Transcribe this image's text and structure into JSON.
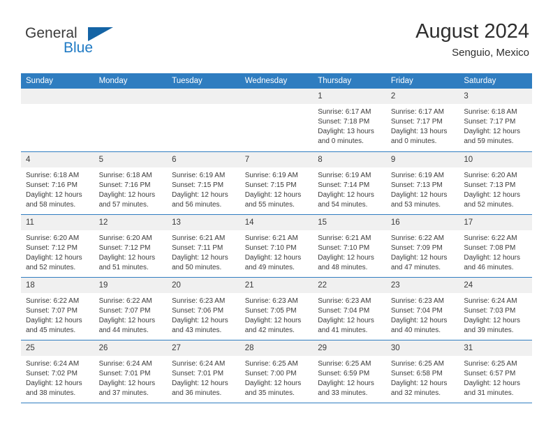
{
  "brand": {
    "name_part1": "General",
    "name_part2": "Blue",
    "flag_icon": "triangle-flag-icon"
  },
  "header": {
    "title": "August 2024",
    "subtitle": "Senguio, Mexico"
  },
  "colors": {
    "header_blue": "#2f7dc0",
    "brand_blue": "#1f7ac4",
    "daynum_bg": "#f0f0f0",
    "text": "#3a3a3a"
  },
  "weekdays": [
    "Sunday",
    "Monday",
    "Tuesday",
    "Wednesday",
    "Thursday",
    "Friday",
    "Saturday"
  ],
  "weeks": [
    [
      {
        "day": "",
        "empty": true
      },
      {
        "day": "",
        "empty": true
      },
      {
        "day": "",
        "empty": true
      },
      {
        "day": "",
        "empty": true
      },
      {
        "day": "1",
        "sunrise": "Sunrise: 6:17 AM",
        "sunset": "Sunset: 7:18 PM",
        "daylight1": "Daylight: 13 hours",
        "daylight2": "and 0 minutes."
      },
      {
        "day": "2",
        "sunrise": "Sunrise: 6:17 AM",
        "sunset": "Sunset: 7:17 PM",
        "daylight1": "Daylight: 13 hours",
        "daylight2": "and 0 minutes."
      },
      {
        "day": "3",
        "sunrise": "Sunrise: 6:18 AM",
        "sunset": "Sunset: 7:17 PM",
        "daylight1": "Daylight: 12 hours",
        "daylight2": "and 59 minutes."
      }
    ],
    [
      {
        "day": "4",
        "sunrise": "Sunrise: 6:18 AM",
        "sunset": "Sunset: 7:16 PM",
        "daylight1": "Daylight: 12 hours",
        "daylight2": "and 58 minutes."
      },
      {
        "day": "5",
        "sunrise": "Sunrise: 6:18 AM",
        "sunset": "Sunset: 7:16 PM",
        "daylight1": "Daylight: 12 hours",
        "daylight2": "and 57 minutes."
      },
      {
        "day": "6",
        "sunrise": "Sunrise: 6:19 AM",
        "sunset": "Sunset: 7:15 PM",
        "daylight1": "Daylight: 12 hours",
        "daylight2": "and 56 minutes."
      },
      {
        "day": "7",
        "sunrise": "Sunrise: 6:19 AM",
        "sunset": "Sunset: 7:15 PM",
        "daylight1": "Daylight: 12 hours",
        "daylight2": "and 55 minutes."
      },
      {
        "day": "8",
        "sunrise": "Sunrise: 6:19 AM",
        "sunset": "Sunset: 7:14 PM",
        "daylight1": "Daylight: 12 hours",
        "daylight2": "and 54 minutes."
      },
      {
        "day": "9",
        "sunrise": "Sunrise: 6:19 AM",
        "sunset": "Sunset: 7:13 PM",
        "daylight1": "Daylight: 12 hours",
        "daylight2": "and 53 minutes."
      },
      {
        "day": "10",
        "sunrise": "Sunrise: 6:20 AM",
        "sunset": "Sunset: 7:13 PM",
        "daylight1": "Daylight: 12 hours",
        "daylight2": "and 52 minutes."
      }
    ],
    [
      {
        "day": "11",
        "sunrise": "Sunrise: 6:20 AM",
        "sunset": "Sunset: 7:12 PM",
        "daylight1": "Daylight: 12 hours",
        "daylight2": "and 52 minutes."
      },
      {
        "day": "12",
        "sunrise": "Sunrise: 6:20 AM",
        "sunset": "Sunset: 7:12 PM",
        "daylight1": "Daylight: 12 hours",
        "daylight2": "and 51 minutes."
      },
      {
        "day": "13",
        "sunrise": "Sunrise: 6:21 AM",
        "sunset": "Sunset: 7:11 PM",
        "daylight1": "Daylight: 12 hours",
        "daylight2": "and 50 minutes."
      },
      {
        "day": "14",
        "sunrise": "Sunrise: 6:21 AM",
        "sunset": "Sunset: 7:10 PM",
        "daylight1": "Daylight: 12 hours",
        "daylight2": "and 49 minutes."
      },
      {
        "day": "15",
        "sunrise": "Sunrise: 6:21 AM",
        "sunset": "Sunset: 7:10 PM",
        "daylight1": "Daylight: 12 hours",
        "daylight2": "and 48 minutes."
      },
      {
        "day": "16",
        "sunrise": "Sunrise: 6:22 AM",
        "sunset": "Sunset: 7:09 PM",
        "daylight1": "Daylight: 12 hours",
        "daylight2": "and 47 minutes."
      },
      {
        "day": "17",
        "sunrise": "Sunrise: 6:22 AM",
        "sunset": "Sunset: 7:08 PM",
        "daylight1": "Daylight: 12 hours",
        "daylight2": "and 46 minutes."
      }
    ],
    [
      {
        "day": "18",
        "sunrise": "Sunrise: 6:22 AM",
        "sunset": "Sunset: 7:07 PM",
        "daylight1": "Daylight: 12 hours",
        "daylight2": "and 45 minutes."
      },
      {
        "day": "19",
        "sunrise": "Sunrise: 6:22 AM",
        "sunset": "Sunset: 7:07 PM",
        "daylight1": "Daylight: 12 hours",
        "daylight2": "and 44 minutes."
      },
      {
        "day": "20",
        "sunrise": "Sunrise: 6:23 AM",
        "sunset": "Sunset: 7:06 PM",
        "daylight1": "Daylight: 12 hours",
        "daylight2": "and 43 minutes."
      },
      {
        "day": "21",
        "sunrise": "Sunrise: 6:23 AM",
        "sunset": "Sunset: 7:05 PM",
        "daylight1": "Daylight: 12 hours",
        "daylight2": "and 42 minutes."
      },
      {
        "day": "22",
        "sunrise": "Sunrise: 6:23 AM",
        "sunset": "Sunset: 7:04 PM",
        "daylight1": "Daylight: 12 hours",
        "daylight2": "and 41 minutes."
      },
      {
        "day": "23",
        "sunrise": "Sunrise: 6:23 AM",
        "sunset": "Sunset: 7:04 PM",
        "daylight1": "Daylight: 12 hours",
        "daylight2": "and 40 minutes."
      },
      {
        "day": "24",
        "sunrise": "Sunrise: 6:24 AM",
        "sunset": "Sunset: 7:03 PM",
        "daylight1": "Daylight: 12 hours",
        "daylight2": "and 39 minutes."
      }
    ],
    [
      {
        "day": "25",
        "sunrise": "Sunrise: 6:24 AM",
        "sunset": "Sunset: 7:02 PM",
        "daylight1": "Daylight: 12 hours",
        "daylight2": "and 38 minutes."
      },
      {
        "day": "26",
        "sunrise": "Sunrise: 6:24 AM",
        "sunset": "Sunset: 7:01 PM",
        "daylight1": "Daylight: 12 hours",
        "daylight2": "and 37 minutes."
      },
      {
        "day": "27",
        "sunrise": "Sunrise: 6:24 AM",
        "sunset": "Sunset: 7:01 PM",
        "daylight1": "Daylight: 12 hours",
        "daylight2": "and 36 minutes."
      },
      {
        "day": "28",
        "sunrise": "Sunrise: 6:25 AM",
        "sunset": "Sunset: 7:00 PM",
        "daylight1": "Daylight: 12 hours",
        "daylight2": "and 35 minutes."
      },
      {
        "day": "29",
        "sunrise": "Sunrise: 6:25 AM",
        "sunset": "Sunset: 6:59 PM",
        "daylight1": "Daylight: 12 hours",
        "daylight2": "and 33 minutes."
      },
      {
        "day": "30",
        "sunrise": "Sunrise: 6:25 AM",
        "sunset": "Sunset: 6:58 PM",
        "daylight1": "Daylight: 12 hours",
        "daylight2": "and 32 minutes."
      },
      {
        "day": "31",
        "sunrise": "Sunrise: 6:25 AM",
        "sunset": "Sunset: 6:57 PM",
        "daylight1": "Daylight: 12 hours",
        "daylight2": "and 31 minutes."
      }
    ]
  ]
}
